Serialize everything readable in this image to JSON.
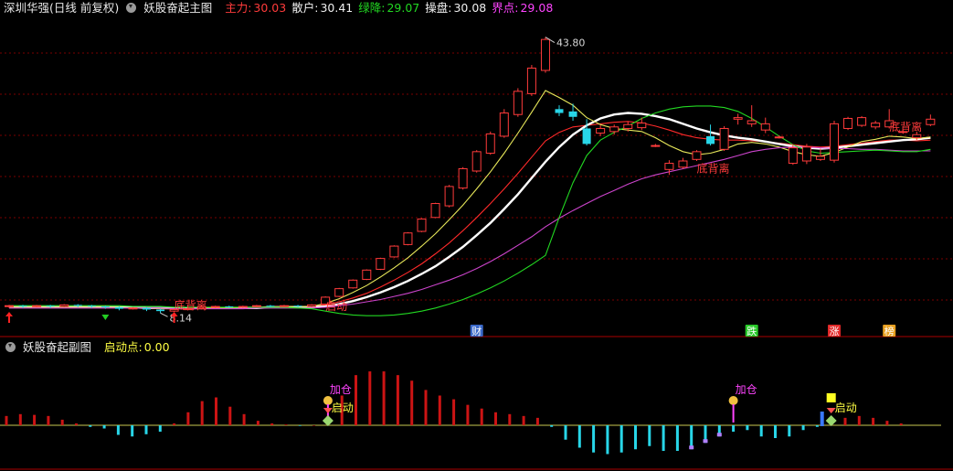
{
  "main_header": {
    "title": "深圳华强(日线 前复权)",
    "indicator": "妖股奋起主图",
    "legend": [
      {
        "label": "主力:",
        "value": "30.03",
        "color": "#ff3b3b"
      },
      {
        "label": "散户:",
        "value": "30.41",
        "color": "#f0f0f0"
      },
      {
        "label": "绿降:",
        "value": "29.07",
        "color": "#22d822"
      },
      {
        "label": "操盘:",
        "value": "30.08",
        "color": "#f0f0f0"
      },
      {
        "label": "界点:",
        "value": "29.08",
        "color": "#ff44ff"
      }
    ]
  },
  "sub_header": {
    "indicator": "妖股奋起副图",
    "legend": [
      {
        "label": "启动点:",
        "value": "0.00",
        "color": "#ffff44"
      }
    ]
  },
  "colors": {
    "up": "#ff3b3b",
    "down": "#28d6e8",
    "white": "#ffffff",
    "yellow": "#e8e85a",
    "red": "#ff2a2a",
    "magenta": "#cc44cc",
    "green": "#22d822",
    "grid": "#7a0000"
  },
  "chart_data": [
    {
      "type": "candlestick",
      "ylim": [
        7.0,
        46.0
      ],
      "high_label": "43.80",
      "low_label": "8.14",
      "candles": [
        [
          0,
          9.0,
          9.1,
          8.8,
          9.2
        ],
        [
          1,
          9.1,
          9.0,
          8.8,
          9.2
        ],
        [
          2,
          9.0,
          9.1,
          8.9,
          9.2
        ],
        [
          3,
          9.1,
          9.0,
          8.8,
          9.2
        ],
        [
          4,
          9.0,
          9.2,
          8.9,
          9.3
        ],
        [
          5,
          9.2,
          9.1,
          8.9,
          9.3
        ],
        [
          6,
          9.1,
          9.0,
          8.8,
          9.2
        ],
        [
          7,
          9.0,
          8.9,
          8.7,
          9.1
        ],
        [
          8,
          8.9,
          8.7,
          8.5,
          9.0
        ],
        [
          9,
          8.7,
          8.8,
          8.6,
          8.9
        ],
        [
          10,
          8.8,
          8.6,
          8.4,
          8.9
        ],
        [
          11,
          8.6,
          8.4,
          8.14,
          8.7
        ],
        [
          12,
          8.4,
          8.6,
          8.3,
          8.7
        ],
        [
          13,
          8.6,
          8.7,
          8.5,
          8.8
        ],
        [
          14,
          8.7,
          8.9,
          8.6,
          9.0
        ],
        [
          15,
          8.9,
          9.0,
          8.8,
          9.1
        ],
        [
          16,
          9.0,
          8.9,
          8.8,
          9.1
        ],
        [
          17,
          8.9,
          9.0,
          8.8,
          9.1
        ],
        [
          18,
          9.0,
          9.1,
          8.9,
          9.2
        ],
        [
          19,
          9.1,
          9.0,
          8.9,
          9.2
        ],
        [
          20,
          9.0,
          9.1,
          8.9,
          9.2
        ],
        [
          21,
          9.1,
          9.0,
          8.9,
          9.2
        ],
        [
          22,
          9.0,
          9.2,
          8.9,
          9.3
        ],
        [
          23,
          9.3,
          10.2,
          9.2,
          10.3
        ],
        [
          24,
          10.3,
          11.3,
          10.2,
          11.4
        ],
        [
          25,
          11.4,
          12.4,
          11.3,
          12.5
        ],
        [
          26,
          12.5,
          13.7,
          12.4,
          13.8
        ],
        [
          27,
          13.8,
          15.2,
          13.7,
          15.3
        ],
        [
          28,
          15.4,
          16.8,
          15.3,
          16.9
        ],
        [
          29,
          17.0,
          18.5,
          16.9,
          18.6
        ],
        [
          30,
          18.7,
          20.3,
          18.6,
          20.4
        ],
        [
          31,
          20.5,
          22.3,
          20.4,
          22.4
        ],
        [
          32,
          22.0,
          24.5,
          21.8,
          24.7
        ],
        [
          33,
          24.3,
          26.8,
          24.1,
          27.0
        ],
        [
          34,
          26.5,
          29.0,
          26.3,
          29.2
        ],
        [
          35,
          28.8,
          31.3,
          28.6,
          31.6
        ],
        [
          36,
          31.0,
          34.0,
          30.8,
          34.5
        ],
        [
          37,
          33.8,
          36.8,
          33.5,
          37.2
        ],
        [
          38,
          36.5,
          39.8,
          36.2,
          40.2
        ],
        [
          39,
          39.5,
          43.5,
          39.2,
          43.8
        ],
        [
          40,
          34.5,
          34.0,
          33.6,
          35.0
        ],
        [
          41,
          34.2,
          33.5,
          33.0,
          35.2
        ],
        [
          42,
          32.0,
          30.0,
          29.8,
          33.2
        ],
        [
          43,
          31.4,
          32.0,
          31.0,
          32.4
        ],
        [
          44,
          31.6,
          32.2,
          31.2,
          32.5
        ],
        [
          45,
          32.0,
          32.5,
          31.6,
          32.9
        ],
        [
          46,
          32.1,
          32.7,
          31.8,
          33.4
        ],
        [
          47,
          29.8,
          29.8,
          29.6,
          30.0
        ],
        [
          48,
          26.7,
          27.5,
          26.0,
          27.9
        ],
        [
          49,
          27.0,
          27.8,
          26.8,
          28.2
        ],
        [
          50,
          28.0,
          29.0,
          27.8,
          29.2
        ],
        [
          51,
          31.0,
          30.0,
          29.8,
          32.5
        ],
        [
          52,
          29.3,
          32.0,
          29.1,
          32.3
        ],
        [
          53,
          33.2,
          33.4,
          32.5,
          33.9
        ],
        [
          54,
          32.6,
          33.0,
          32.2,
          35.0
        ],
        [
          55,
          31.8,
          32.6,
          31.4,
          33.4
        ],
        [
          56,
          30.9,
          30.9,
          30.7,
          31.1
        ],
        [
          57,
          27.5,
          29.5,
          27.3,
          30.0
        ],
        [
          58,
          27.8,
          29.6,
          27.4,
          30.0
        ],
        [
          59,
          28.0,
          28.4,
          27.8,
          29.4
        ],
        [
          60,
          27.9,
          32.6,
          27.6,
          33.0
        ],
        [
          61,
          32.0,
          33.3,
          31.8,
          33.5
        ],
        [
          62,
          32.4,
          33.4,
          32.2,
          33.6
        ],
        [
          63,
          32.2,
          32.7,
          31.9,
          33.0
        ],
        [
          64,
          32.2,
          33.0,
          32.0,
          34.5
        ],
        [
          65,
          31.5,
          31.6,
          31.3,
          31.9
        ],
        [
          66,
          30.8,
          31.2,
          30.5,
          31.6
        ],
        [
          67,
          32.5,
          33.2,
          32.3,
          33.8
        ]
      ],
      "series": [
        {
          "name": "主力",
          "color": "#ff2a2a",
          "values": [
            9.0,
            9.0,
            9.0,
            9.0,
            9.0,
            9.0,
            9.0,
            9.0,
            8.9,
            8.9,
            8.8,
            8.7,
            8.7,
            8.7,
            8.8,
            8.8,
            8.9,
            8.9,
            8.9,
            9.0,
            9.0,
            9.0,
            9.0,
            9.2,
            9.6,
            10.1,
            10.7,
            11.5,
            12.4,
            13.4,
            14.5,
            15.8,
            17.2,
            18.8,
            20.5,
            22.3,
            24.2,
            26.2,
            28.3,
            30.4,
            31.5,
            32.2,
            32.4,
            32.6,
            32.8,
            32.9,
            32.7,
            32.3,
            31.8,
            31.2,
            30.8,
            30.6,
            30.5,
            30.5,
            30.4,
            30.3,
            30.1,
            29.9,
            29.7,
            29.6,
            29.7,
            29.9,
            30.1,
            30.3,
            30.5,
            30.5,
            30.4,
            30.5
          ]
        },
        {
          "name": "散户",
          "color": "#ffffff",
          "values": [
            8.9,
            8.9,
            8.9,
            8.9,
            8.9,
            8.9,
            8.9,
            8.9,
            8.9,
            8.9,
            8.8,
            8.8,
            8.8,
            8.8,
            8.8,
            8.8,
            8.8,
            8.8,
            8.8,
            8.9,
            8.9,
            8.9,
            8.9,
            9.0,
            9.3,
            9.7,
            10.2,
            10.8,
            11.5,
            12.3,
            13.2,
            14.2,
            15.4,
            16.7,
            18.2,
            19.8,
            21.6,
            23.5,
            25.6,
            27.7,
            29.6,
            31.2,
            32.4,
            33.3,
            33.8,
            34.0,
            33.9,
            33.6,
            33.2,
            32.6,
            32.0,
            31.5,
            31.1,
            30.8,
            30.6,
            30.3,
            30.0,
            29.7,
            29.5,
            29.4,
            29.5,
            29.7,
            29.9,
            30.1,
            30.3,
            30.5,
            30.6,
            30.8
          ]
        },
        {
          "name": "操盘",
          "color": "#e8e85a",
          "values": [
            8.9,
            8.9,
            8.9,
            8.9,
            8.9,
            8.9,
            8.9,
            8.9,
            8.9,
            8.8,
            8.8,
            8.7,
            8.7,
            8.7,
            8.7,
            8.8,
            8.8,
            8.9,
            8.9,
            8.9,
            9.0,
            9.0,
            9.0,
            9.4,
            10.0,
            10.8,
            11.7,
            12.8,
            14.0,
            15.3,
            16.8,
            18.4,
            20.2,
            22.1,
            24.2,
            26.4,
            28.8,
            31.4,
            34.1,
            36.9,
            36.0,
            35.0,
            33.4,
            32.5,
            32.0,
            31.8,
            31.6,
            30.8,
            29.8,
            29.0,
            28.6,
            28.8,
            29.3,
            30.0,
            30.2,
            30.0,
            29.6,
            29.0,
            28.6,
            28.4,
            28.9,
            29.6,
            30.3,
            30.6,
            31.0,
            30.9,
            30.7,
            30.9
          ]
        },
        {
          "name": "界点",
          "color": "#cc44cc",
          "values": [
            8.8,
            8.8,
            8.8,
            8.8,
            8.8,
            8.8,
            8.8,
            8.8,
            8.8,
            8.8,
            8.8,
            8.8,
            8.7,
            8.7,
            8.7,
            8.7,
            8.7,
            8.7,
            8.8,
            8.8,
            8.8,
            8.8,
            8.8,
            8.9,
            9.1,
            9.3,
            9.6,
            9.9,
            10.3,
            10.7,
            11.2,
            11.8,
            12.4,
            13.1,
            13.9,
            14.8,
            15.8,
            16.9,
            18.0,
            19.3,
            20.4,
            21.4,
            22.3,
            23.2,
            24.0,
            24.8,
            25.5,
            26.0,
            26.4,
            26.8,
            27.2,
            27.6,
            28.0,
            28.5,
            29.0,
            29.3,
            29.5,
            29.6,
            29.6,
            29.5,
            29.4,
            29.4,
            29.3,
            29.3,
            29.2,
            29.1,
            29.1,
            29.1
          ]
        },
        {
          "name": "绿降",
          "color": "#22d822",
          "values": [
            9.1,
            9.1,
            9.1,
            9.1,
            9.1,
            9.1,
            9.1,
            9.1,
            9.1,
            9.0,
            9.0,
            9.0,
            8.9,
            8.9,
            8.9,
            8.9,
            8.9,
            8.9,
            8.9,
            8.9,
            8.9,
            8.8,
            8.7,
            8.4,
            8.1,
            7.9,
            7.8,
            7.8,
            7.9,
            8.1,
            8.4,
            8.8,
            9.3,
            9.9,
            10.6,
            11.4,
            12.3,
            13.3,
            14.4,
            15.6,
            20.5,
            25.0,
            28.5,
            30.5,
            31.5,
            32.3,
            33.3,
            34.0,
            34.5,
            34.8,
            34.9,
            34.9,
            34.7,
            34.2,
            33.3,
            32.2,
            31.0,
            29.9,
            29.1,
            28.8,
            28.9,
            29.0,
            29.1,
            29.2,
            29.1,
            29.0,
            29.0,
            29.3
          ]
        }
      ],
      "annotations": [
        {
          "i": 0,
          "text": "",
          "kind": "up-arrow"
        },
        {
          "i": 7,
          "text": "",
          "kind": "down-triangle"
        },
        {
          "i": 12,
          "text": "",
          "kind": "up-arrow"
        },
        {
          "i": 12,
          "text": "底背离",
          "kind": "label",
          "price": 9.1
        },
        {
          "i": 23,
          "text": "启动",
          "kind": "label",
          "price": 9.0
        },
        {
          "i": 50,
          "text": "底背离",
          "kind": "label",
          "price": 26.8
        },
        {
          "i": 64,
          "text": "底背离",
          "kind": "label",
          "price": 32.2
        }
      ],
      "bottom_tags": [
        {
          "i": 34,
          "text": "财",
          "bg": "#3a68c8",
          "fg": "#ffffff"
        },
        {
          "i": 54,
          "text": "跌",
          "bg": "#28c828",
          "fg": "#ffffff"
        },
        {
          "i": 60,
          "text": "涨",
          "bg": "#e02828",
          "fg": "#ffffff"
        },
        {
          "i": 64,
          "text": "榜",
          "bg": "#e8a020",
          "fg": "#ffffff"
        }
      ]
    },
    {
      "type": "bar",
      "ylim": [
        -1.0,
        1.6
      ],
      "values": [
        0.25,
        0.3,
        0.28,
        0.25,
        0.15,
        0.05,
        -0.05,
        -0.1,
        -0.3,
        -0.35,
        -0.28,
        -0.2,
        0.05,
        0.35,
        0.65,
        0.75,
        0.5,
        0.3,
        0.12,
        0.05,
        0.02,
        -0.02,
        0.0,
        0.25,
        0.8,
        1.35,
        1.45,
        1.45,
        1.35,
        1.2,
        0.95,
        0.8,
        0.7,
        0.55,
        0.45,
        0.35,
        0.3,
        0.25,
        0.2,
        -0.05,
        -0.45,
        -0.7,
        -0.85,
        -0.9,
        -0.85,
        -0.75,
        -0.65,
        -0.8,
        -0.8,
        -0.75,
        -0.55,
        -0.35,
        -0.2,
        -0.15,
        -0.35,
        -0.4,
        -0.35,
        -0.15,
        -0.05,
        0.15,
        0.2,
        0.25,
        0.2,
        0.12,
        0.05
      ],
      "bar_start": 0,
      "annotations": [
        {
          "i": 23,
          "text": "加仓",
          "kind": "label-top"
        },
        {
          "i": 23,
          "text": "启动",
          "kind": "label-side"
        },
        {
          "i": 52,
          "text": "加仓",
          "kind": "label-top"
        },
        {
          "i": 59,
          "text": "启动",
          "kind": "label-side"
        }
      ]
    }
  ]
}
